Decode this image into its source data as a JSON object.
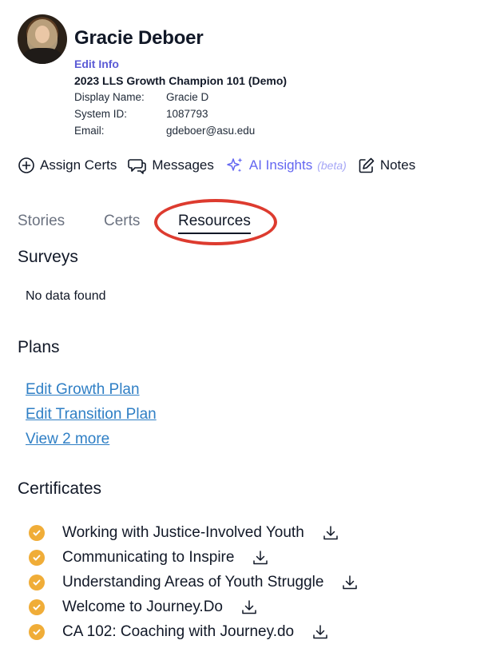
{
  "profile": {
    "name": "Gracie Deboer",
    "edit_label": "Edit Info",
    "program": "2023 LLS Growth Champion 101 (Demo)",
    "fields": [
      {
        "label": "Display Name:",
        "value": "Gracie D"
      },
      {
        "label": "System ID:",
        "value": "1087793"
      },
      {
        "label": "Email:",
        "value": "gdeboer@asu.edu"
      }
    ]
  },
  "actions": {
    "assign": "Assign Certs",
    "messages": "Messages",
    "ai": "AI Insights",
    "ai_beta": "(beta)",
    "notes": "Notes"
  },
  "tabs": {
    "stories": "Stories",
    "certs": "Certs",
    "resources": "Resources",
    "active": "Resources"
  },
  "surveys": {
    "heading": "Surveys",
    "empty": "No data found"
  },
  "plans": {
    "heading": "Plans",
    "links": [
      "Edit Growth Plan",
      "Edit Transition Plan",
      "View 2 more"
    ]
  },
  "certificates": {
    "heading": "Certificates",
    "items": [
      "Working with Justice-Involved Youth",
      "Communicating to Inspire",
      "Understanding Areas of Youth Struggle",
      "Welcome to Journey.Do",
      "CA 102: Coaching with Journey.do"
    ]
  },
  "colors": {
    "accent": "#5b5bd6",
    "link": "#2f7fc5",
    "badge": "#f0ad38",
    "annotation": "#dd3b2f"
  }
}
